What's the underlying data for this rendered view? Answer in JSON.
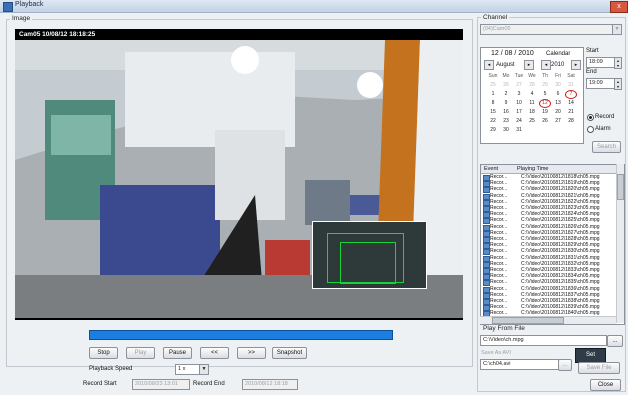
{
  "window": {
    "title": "Playback",
    "close_glyph": "x"
  },
  "image_panel": {
    "label": "Image",
    "osd": "Cam05  10/08/12 18:18:25"
  },
  "controls": {
    "stop": "Stop",
    "play": "Play",
    "pause": "Pause",
    "rewind": "<<",
    "forward": ">>",
    "snapshot": "Snapshot",
    "playback_speed_label": "Playback Speed",
    "playback_speed_value": "1 x",
    "record_start_label": "Record Start",
    "record_start_value": "2010/08/23 13:01",
    "record_end_label": "Record End",
    "record_end_value": "2010/08/12 18:18"
  },
  "channel": {
    "label": "Channel",
    "value": "(04)Cam05"
  },
  "calendar": {
    "date_header": "12 / 08 / 2010",
    "calendar_button": "Calendar",
    "month": "August",
    "year": "2010",
    "weekdays": [
      "Sun",
      "Mo",
      "Tue",
      "We",
      "Th",
      "Fri",
      "Sat"
    ],
    "weeks": [
      [
        "25",
        "26",
        "27",
        "28",
        "29",
        "30",
        "31"
      ],
      [
        "1",
        "2",
        "3",
        "4",
        "5",
        "6",
        "7"
      ],
      [
        "8",
        "9",
        "10",
        "11",
        "12",
        "13",
        "14"
      ],
      [
        "15",
        "16",
        "17",
        "18",
        "19",
        "20",
        "21"
      ],
      [
        "22",
        "23",
        "24",
        "25",
        "26",
        "27",
        "28"
      ],
      [
        "29",
        "30",
        "31",
        "",
        "",
        "",
        ""
      ]
    ]
  },
  "time": {
    "start_label": "Start",
    "start_value": "18:09",
    "end_label": "End",
    "end_value": "19:09",
    "record_option": "Record",
    "alarm_option": "Alarm",
    "search_button": "Search"
  },
  "event_list": {
    "col_event": "Event",
    "col_playing_time": "Playing Time",
    "rows": [
      {
        "event": "Recor...",
        "file": "C:\\Video\\20100812\\1818\\ch05.mpg"
      },
      {
        "event": "Recor...",
        "file": "C:\\Video\\20100812\\1819\\ch05.mpg"
      },
      {
        "event": "Recor...",
        "file": "C:\\Video\\20100812\\1820\\ch05.mpg"
      },
      {
        "event": "Recor...",
        "file": "C:\\Video\\20100812\\1821\\ch05.mpg"
      },
      {
        "event": "Recor...",
        "file": "C:\\Video\\20100812\\1822\\ch05.mpg"
      },
      {
        "event": "Recor...",
        "file": "C:\\Video\\20100812\\1823\\ch05.mpg"
      },
      {
        "event": "Recor...",
        "file": "C:\\Video\\20100812\\1824\\ch05.mpg"
      },
      {
        "event": "Recor...",
        "file": "C:\\Video\\20100812\\1825\\ch05.mpg"
      },
      {
        "event": "Recor...",
        "file": "C:\\Video\\20100812\\1826\\ch05.mpg"
      },
      {
        "event": "Recor...",
        "file": "C:\\Video\\20100812\\1827\\ch05.mpg"
      },
      {
        "event": "Recor...",
        "file": "C:\\Video\\20100812\\1828\\ch05.mpg"
      },
      {
        "event": "Recor...",
        "file": "C:\\Video\\20100812\\1829\\ch05.mpg"
      },
      {
        "event": "Recor...",
        "file": "C:\\Video\\20100812\\1830\\ch05.mpg"
      },
      {
        "event": "Recor...",
        "file": "C:\\Video\\20100812\\1831\\ch05.mpg"
      },
      {
        "event": "Recor...",
        "file": "C:\\Video\\20100812\\1832\\ch05.mpg"
      },
      {
        "event": "Recor...",
        "file": "C:\\Video\\20100812\\1833\\ch05.mpg"
      },
      {
        "event": "Recor...",
        "file": "C:\\Video\\20100812\\1834\\ch05.mpg"
      },
      {
        "event": "Recor...",
        "file": "C:\\Video\\20100812\\1835\\ch05.mpg"
      },
      {
        "event": "Recor...",
        "file": "C:\\Video\\20100812\\1836\\ch05.mpg"
      },
      {
        "event": "Recor...",
        "file": "C:\\Video\\20100812\\1837\\ch05.mpg"
      },
      {
        "event": "Recor...",
        "file": "C:\\Video\\20100812\\1838\\ch05.mpg"
      },
      {
        "event": "Recor...",
        "file": "C:\\Video\\20100812\\1839\\ch05.mpg"
      },
      {
        "event": "Recor...",
        "file": "C:\\Video\\20100812\\1840\\ch05.mpg"
      },
      {
        "event": "Recor...",
        "file": "C:\\Video\\20100812\\1841\\ch05.mpg"
      }
    ]
  },
  "play_from_file": {
    "label": "Play From File",
    "path": "C:\\Video\\ch.mpg",
    "browse": "...",
    "save_as_label": "Save As AVI",
    "save_path": "C:\\ch04.avi",
    "save_browse": "...",
    "set_button": "Set",
    "save_file_button": "Save File",
    "close_button": "Close"
  },
  "colors": {
    "progress": "#1c7fe0",
    "recorded_day": "#c21f1f",
    "overlay_box": "#19d33a"
  }
}
